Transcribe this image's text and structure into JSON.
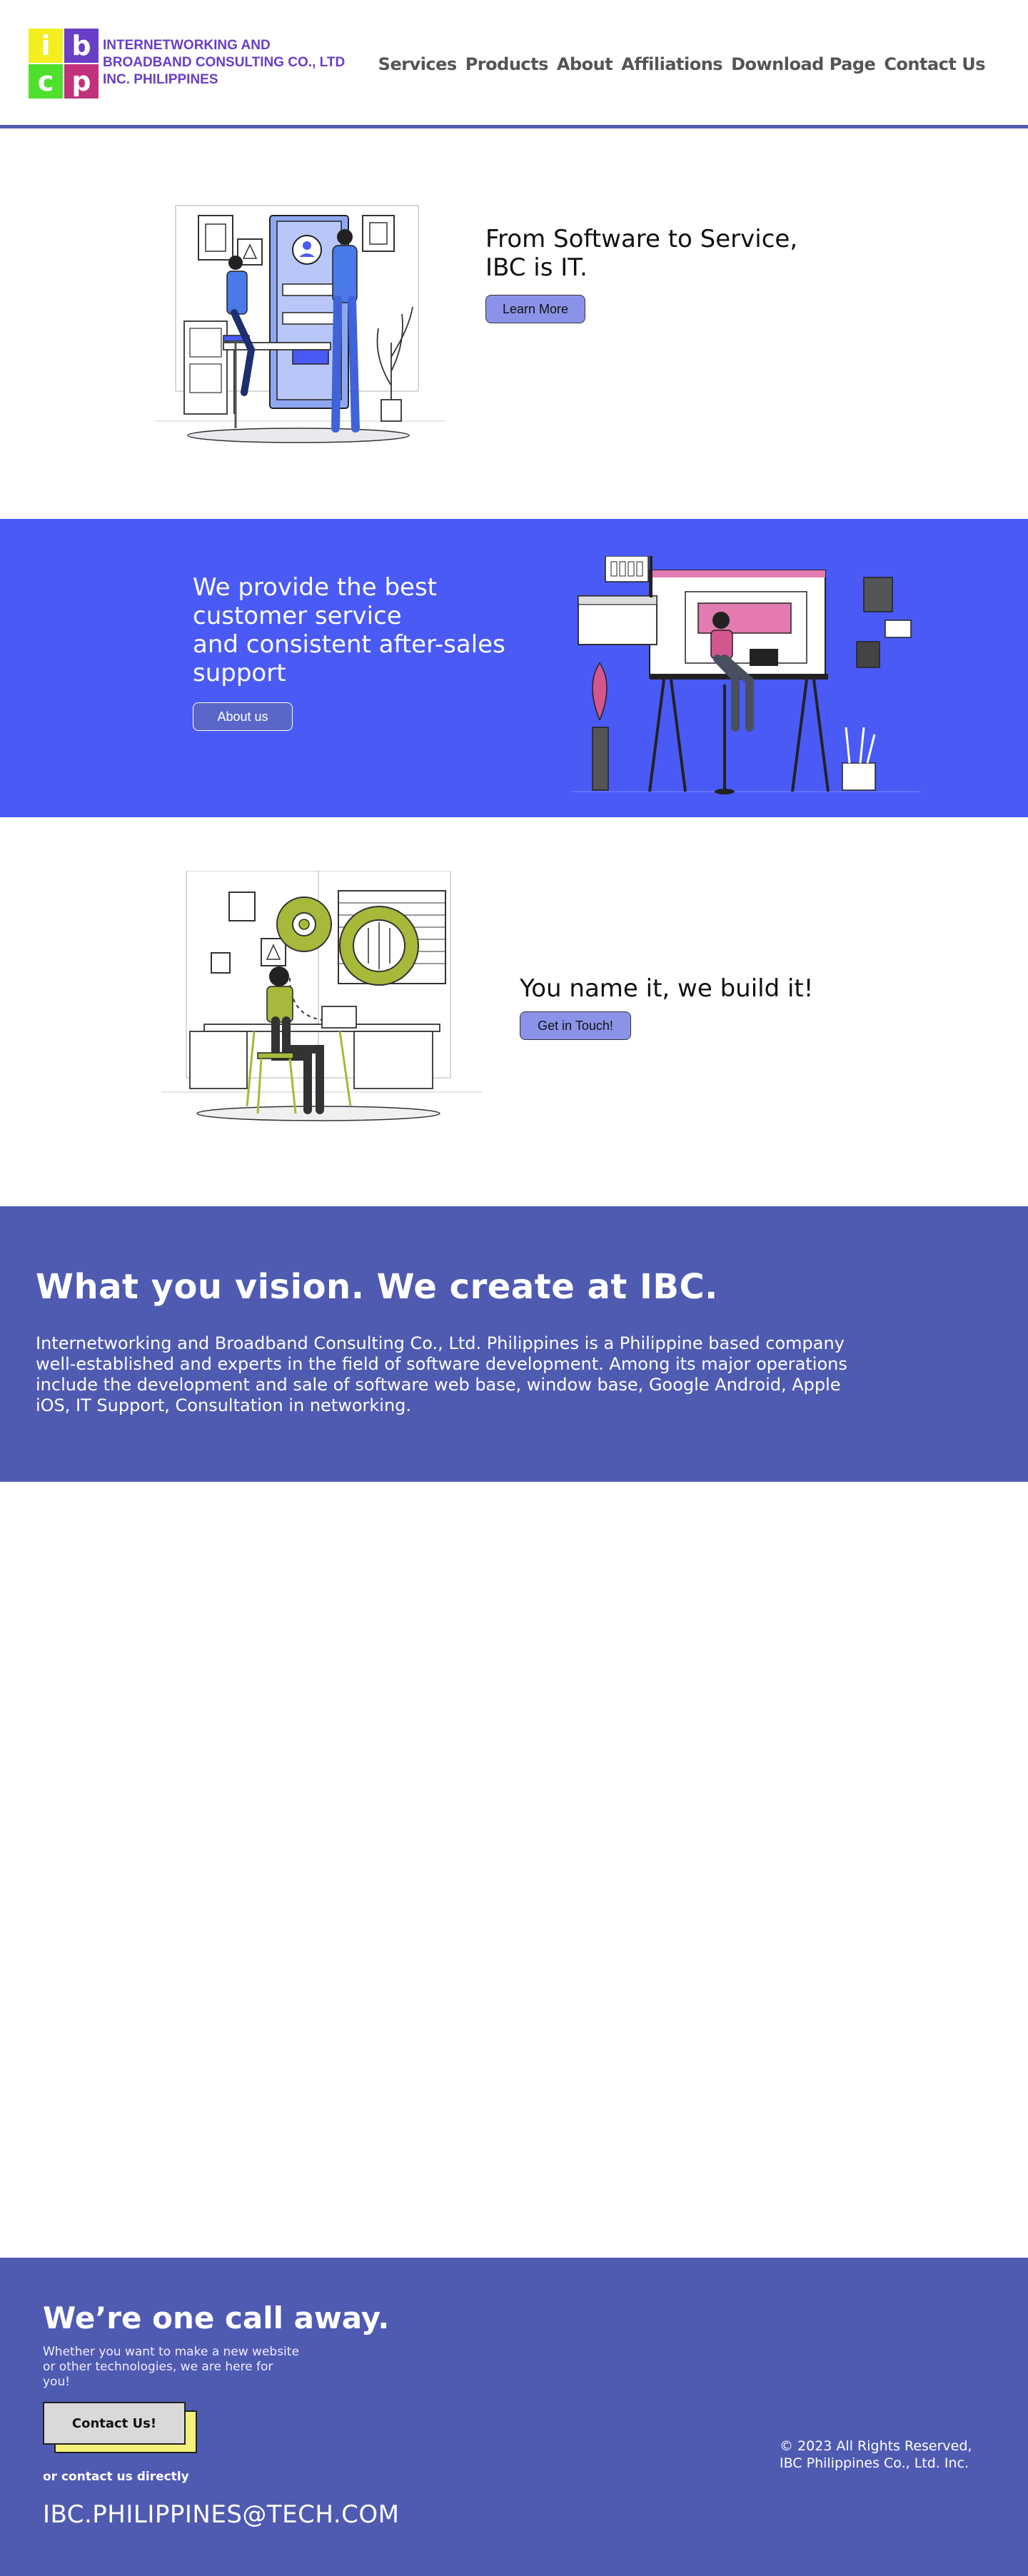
{
  "header": {
    "logo_letters": [
      "i",
      "b",
      "c",
      "p"
    ],
    "company_name": "INTERNETWORKING AND BROADBAND CONSULTING CO., LTD INC. PHILIPPINES",
    "nav": [
      "Services",
      "Products",
      "About",
      "Affiliations",
      "Download Page",
      "Contact Us"
    ],
    "colors": {
      "logo_yellow": "#f2ee1f",
      "logo_purple": "#6a3ec6",
      "logo_green": "#4ee02c",
      "logo_pink": "#c2327c",
      "divider": "#4f5bb1"
    }
  },
  "hero": {
    "headline_line1": "From Software to Service,",
    "headline_line2": "IBC is IT.",
    "button": "Learn More"
  },
  "service": {
    "headline_lines": [
      "We provide the best",
      "customer service",
      "and consistent after-sales",
      "support"
    ],
    "button": "About us",
    "background": "#4a5af5"
  },
  "build": {
    "headline": "You name it, we build it!",
    "button": "Get in Touch!"
  },
  "vision": {
    "headline": "What you vision. We create at IBC.",
    "body": "Internetworking and Broadband Consulting Co., Ltd. Philippines is a Philippine based company well-established and experts in the field of software development. Among its major operations include the development and sale of software web base, window base, Google Android, Apple iOS, IT Support, Consultation in networking.",
    "background": "#4f5bb1"
  },
  "footer": {
    "title": "We’re one call away.",
    "subtitle": "Whether you want to make a new website or other technologies, we are here for you!",
    "cta": "Contact Us!",
    "or_text": "or contact us directly",
    "email": "IBC.PHILIPPINES@TECH.COM",
    "copyright_line1": "© 2023 All Rights Reserved,",
    "copyright_line2": "IBC Philippines Co., Ltd. Inc."
  }
}
